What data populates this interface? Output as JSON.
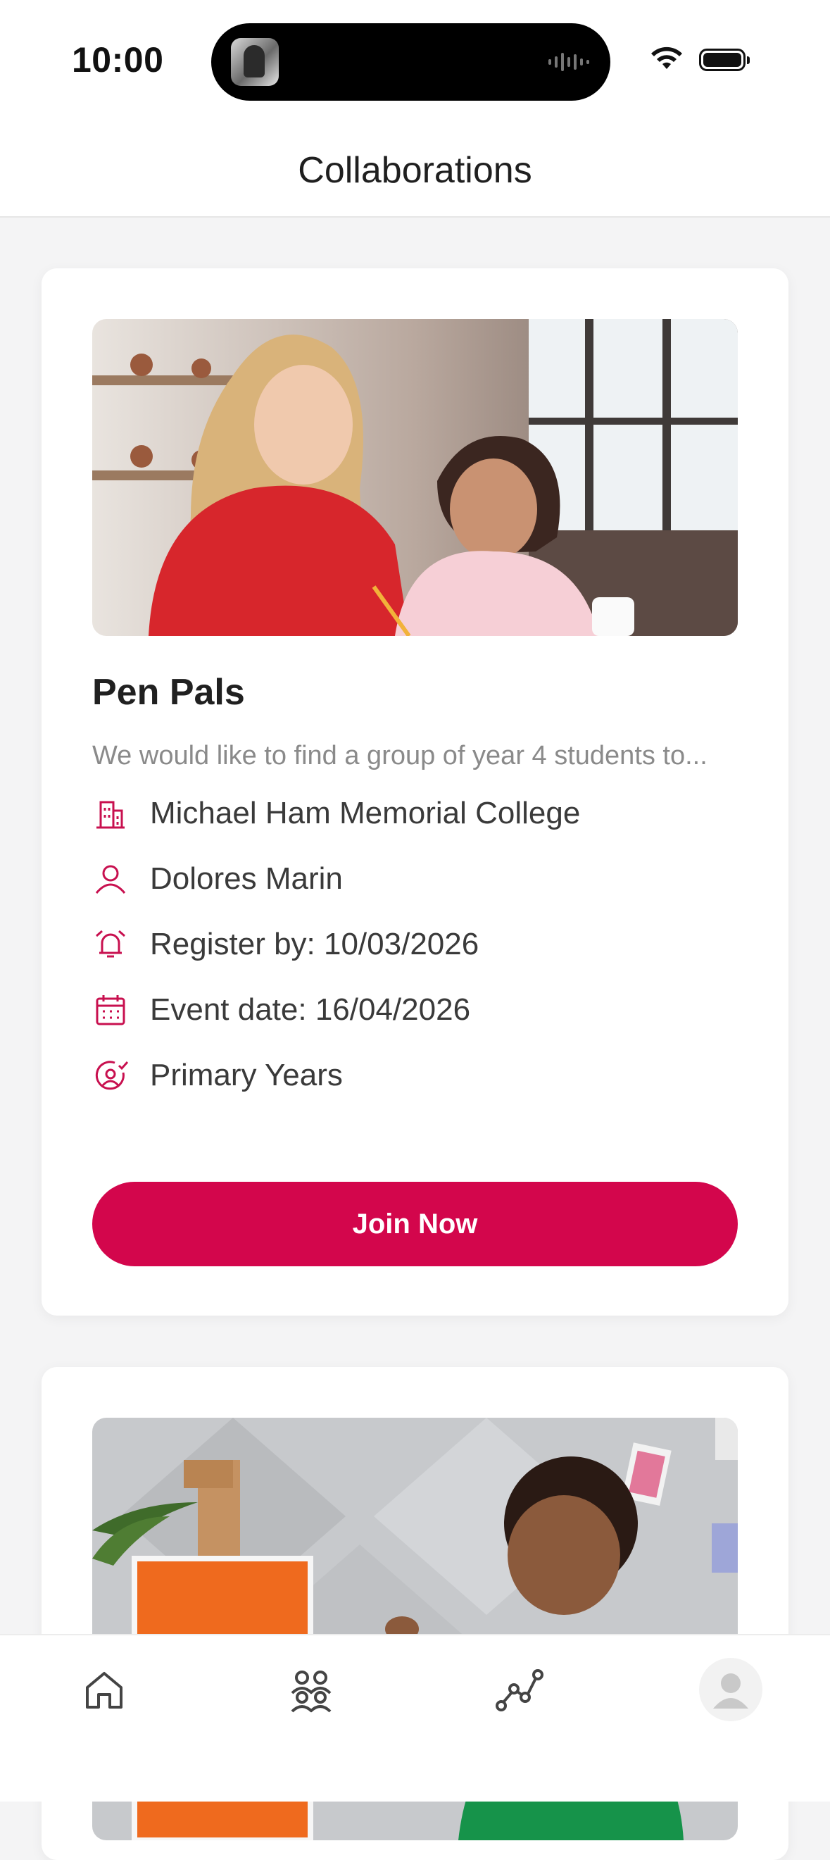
{
  "status_bar": {
    "time": "10:00"
  },
  "header": {
    "title": "Collaborations"
  },
  "cards": [
    {
      "title": "Pen Pals",
      "description": "We would like to find a group of year 4 students to...",
      "school": "Michael Ham Memorial College",
      "organizer": "Dolores Marin",
      "register_by": "Register by: 10/03/2026",
      "event_date": "Event date: 16/04/2026",
      "level": "Primary Years",
      "button_label": "Join Now"
    }
  ],
  "colors": {
    "accent": "#d3064c",
    "background": "#f4f4f5"
  },
  "nav": {
    "items": [
      "home-icon",
      "groups-icon",
      "analytics-icon",
      "profile-avatar"
    ]
  }
}
